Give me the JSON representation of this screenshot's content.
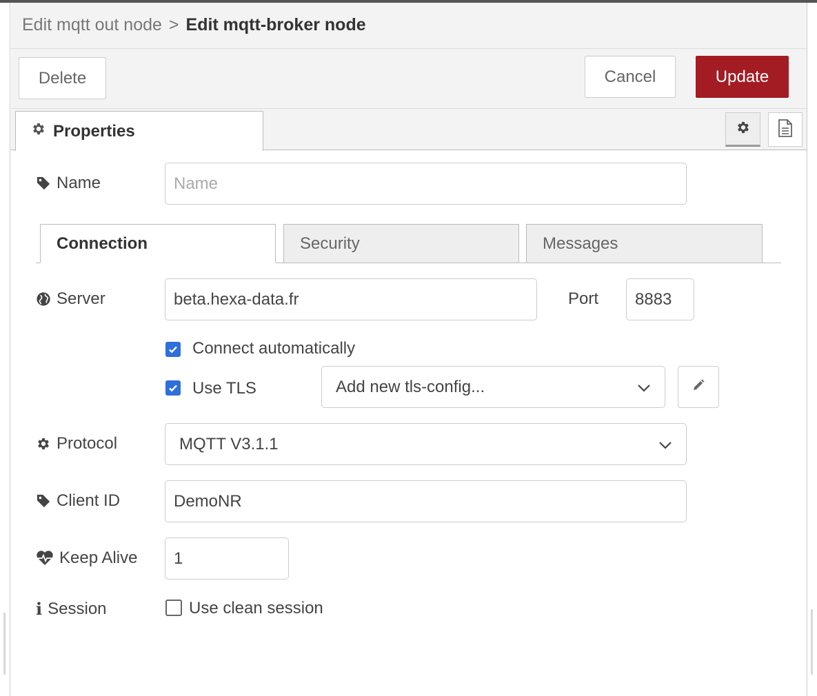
{
  "breadcrumb": {
    "previous": "Edit mqtt out node",
    "separator": ">",
    "current": "Edit mqtt-broker node"
  },
  "toolbar": {
    "delete_label": "Delete",
    "cancel_label": "Cancel",
    "update_label": "Update"
  },
  "tabs": {
    "properties_label": "Properties",
    "settings_icon": "gear-icon",
    "description_icon": "document-icon"
  },
  "name_field": {
    "label": "Name",
    "placeholder": "Name",
    "value": ""
  },
  "subtabs": [
    {
      "label": "Connection",
      "active": true
    },
    {
      "label": "Security",
      "active": false
    },
    {
      "label": "Messages",
      "active": false
    }
  ],
  "server": {
    "label": "Server",
    "value": "beta.hexa-data.fr",
    "port_label": "Port",
    "port_value": "8883"
  },
  "connect_auto": {
    "label": "Connect automatically",
    "checked": true
  },
  "use_tls": {
    "label": "Use TLS",
    "checked": true,
    "select_value": "Add new tls-config..."
  },
  "protocol": {
    "label": "Protocol",
    "value": "MQTT V3.1.1"
  },
  "client_id": {
    "label": "Client ID",
    "value": "DemoNR"
  },
  "keep_alive": {
    "label": "Keep Alive",
    "value": "1"
  },
  "session": {
    "label": "Session",
    "checkbox_label": "Use clean session",
    "checked": false
  },
  "colors": {
    "accent_red": "#a31c24",
    "checkbox_blue": "#2f6fdb",
    "header_bg": "#f3f3f3"
  }
}
